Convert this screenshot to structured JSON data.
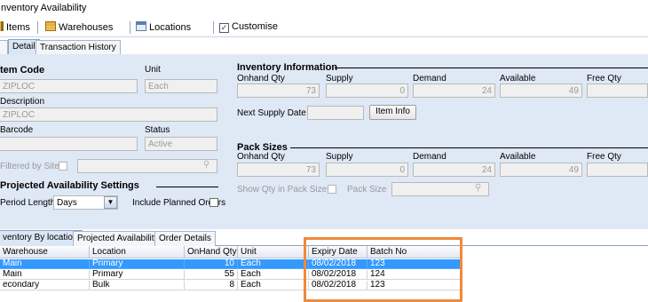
{
  "window": {
    "title": "nventory Availability"
  },
  "toolbar": {
    "items": [
      {
        "label": "Items",
        "icon": "items-icon"
      },
      {
        "label": "Warehouses",
        "icon": "warehouse-icon"
      },
      {
        "label": "Locations",
        "icon": "locations-icon"
      },
      {
        "label": "Customise",
        "icon": "checkbox-icon"
      }
    ]
  },
  "top_tabs": [
    "Detail",
    "Transaction History"
  ],
  "detail": {
    "item_code": {
      "label": "tem Code",
      "value": "ZIPLOC"
    },
    "unit": {
      "label": "Unit",
      "value": "Each"
    },
    "description": {
      "label": "Description",
      "value": "ZIPLOC"
    },
    "barcode": {
      "label": "Barcode",
      "value": ""
    },
    "status": {
      "label": "Status",
      "value": "Active"
    },
    "filtered_by_site": {
      "label": "Filtered by Site"
    }
  },
  "projected": {
    "title": "Projected Availability Settings",
    "period_label": "Period Length",
    "period_value": "Days",
    "include_planned_label": "Include Planned Orders"
  },
  "inventory_info": {
    "title": "Inventory Information",
    "columns": [
      "Onhand Qty",
      "Supply",
      "Demand",
      "Available",
      "Free Qty"
    ],
    "values": [
      "73",
      "0",
      "24",
      "49",
      ""
    ],
    "next_supply_label": "Next Supply Date",
    "next_supply_value": "",
    "item_info_button": "Item Info"
  },
  "pack_sizes": {
    "title": "Pack Sizes",
    "columns": [
      "Onhand Qty",
      "Supply",
      "Demand",
      "Available",
      "Free Qty"
    ],
    "values": [
      "73",
      "0",
      "24",
      "49",
      ""
    ],
    "show_qty_label": "Show Qty in Pack Size",
    "pack_size_label": "Pack Size"
  },
  "bottom_tabs": [
    "ventory By location",
    "Projected Availability",
    "Order Details"
  ],
  "grid": {
    "headers": [
      "Warehouse",
      "Location",
      "OnHand Qty",
      "Unit",
      "Expiry Date",
      "Batch No"
    ],
    "rows": [
      [
        "Main",
        "Primary",
        "10",
        "Each",
        "08/02/2018",
        "123"
      ],
      [
        "Main",
        "Primary",
        "55",
        "Each",
        "08/02/2018",
        "124"
      ],
      [
        "econdary",
        "Bulk",
        "8",
        "Each",
        "08/02/2018",
        "123"
      ]
    ],
    "selected_row": 0
  },
  "colors": {
    "highlight": "#f0893a",
    "selection": "#3399ff",
    "panel": "#dfe8f5"
  }
}
